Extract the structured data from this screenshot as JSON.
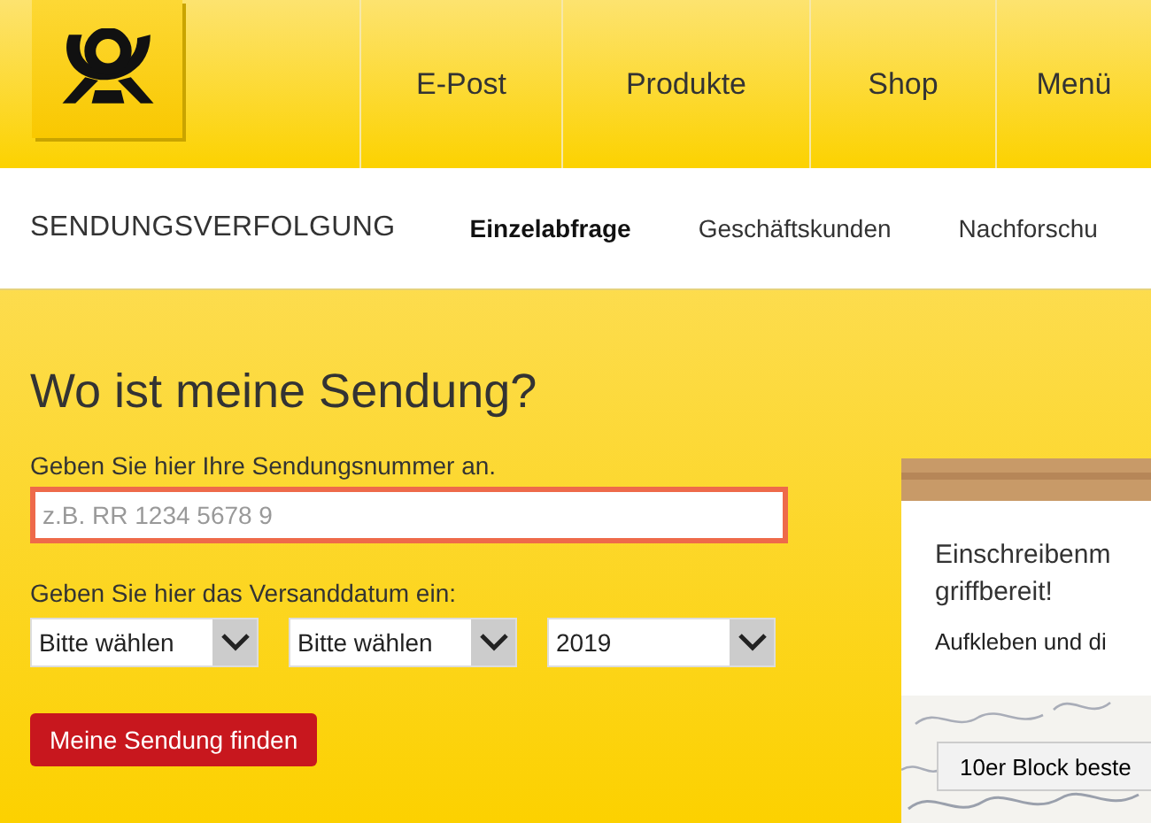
{
  "header": {
    "nav": [
      {
        "label": "E-Post"
      },
      {
        "label": "Produkte"
      },
      {
        "label": "Shop"
      },
      {
        "label": "Menü"
      }
    ]
  },
  "subnav": {
    "title": "SENDUNGSVERFOLGUNG",
    "items": [
      {
        "label": "Einzelabfrage",
        "selected": true
      },
      {
        "label": "Geschäftskunden",
        "selected": false
      },
      {
        "label": "Nachforschu",
        "selected": false
      }
    ]
  },
  "form": {
    "heading": "Wo ist meine Sendung?",
    "number_label": "Geben Sie hier Ihre Sendungsnummer an.",
    "number_field": {
      "placeholder": "z.B. RR 1234 5678 9",
      "invalid": true
    },
    "date_label": "Geben Sie hier das Versanddatum ein:",
    "date_selects": [
      {
        "value": "Bitte wählen"
      },
      {
        "value": "Bitte wählen"
      },
      {
        "value": "2019"
      }
    ],
    "submit": "Meine Sendung finden"
  },
  "promo": {
    "title_line_1": "Einschreibenm",
    "title_line_2": "griffbereit!",
    "text": "Aufkleben und di",
    "button": "10er Block beste"
  }
}
